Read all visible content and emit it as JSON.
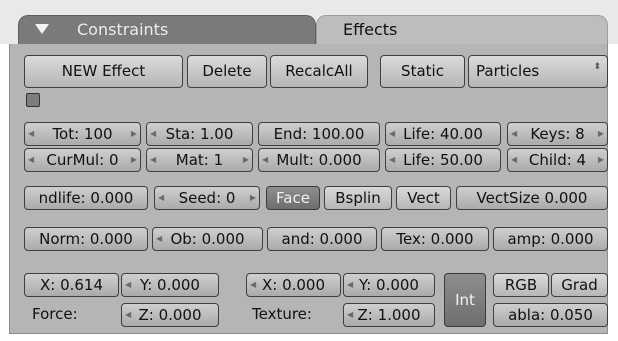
{
  "tabs": {
    "constraints": "Constraints",
    "effects": "Effects"
  },
  "row1": {
    "new_effect": "NEW Effect",
    "delete": "Delete",
    "recalc_all": "RecalcAll",
    "static": "Static",
    "particles": "Particles",
    "select_arrow": "⬍"
  },
  "row2": {
    "tot": "Tot: 100",
    "sta": "Sta: 1.00",
    "end": "End: 100.00",
    "life": "Life: 40.00",
    "keys": "Keys: 8"
  },
  "row3": {
    "curmul": "CurMul: 0",
    "mat": "Mat: 1",
    "mult": "Mult: 0.000",
    "life": "Life: 50.00",
    "child": "Child: 4"
  },
  "row4": {
    "randlife": "ndlife: 0.000",
    "seed": "Seed: 0",
    "face": "Face",
    "bsplin": "Bsplin",
    "vect": "Vect",
    "vectsize": "VectSize 0.000"
  },
  "row5": {
    "norm": "Norm: 0.000",
    "ob": "Ob: 0.000",
    "rand": "and: 0.000",
    "tex": "Tex: 0.000",
    "damp": "amp: 0.000"
  },
  "force": {
    "x": "X: 0.614",
    "y": "Y: 0.000",
    "z": "Z: 0.000",
    "label": "Force:"
  },
  "texture": {
    "x": "X: 0.000",
    "y": "Y: 0.000",
    "z": "Z: 1.000",
    "label": "Texture:"
  },
  "tex_opts": {
    "int": "Int",
    "rgb": "RGB",
    "grad": "Grad",
    "nabla": "abla: 0.050"
  },
  "colors": {
    "panel_bg": "#b5b5b5",
    "active_button": "#7e7e7e"
  }
}
